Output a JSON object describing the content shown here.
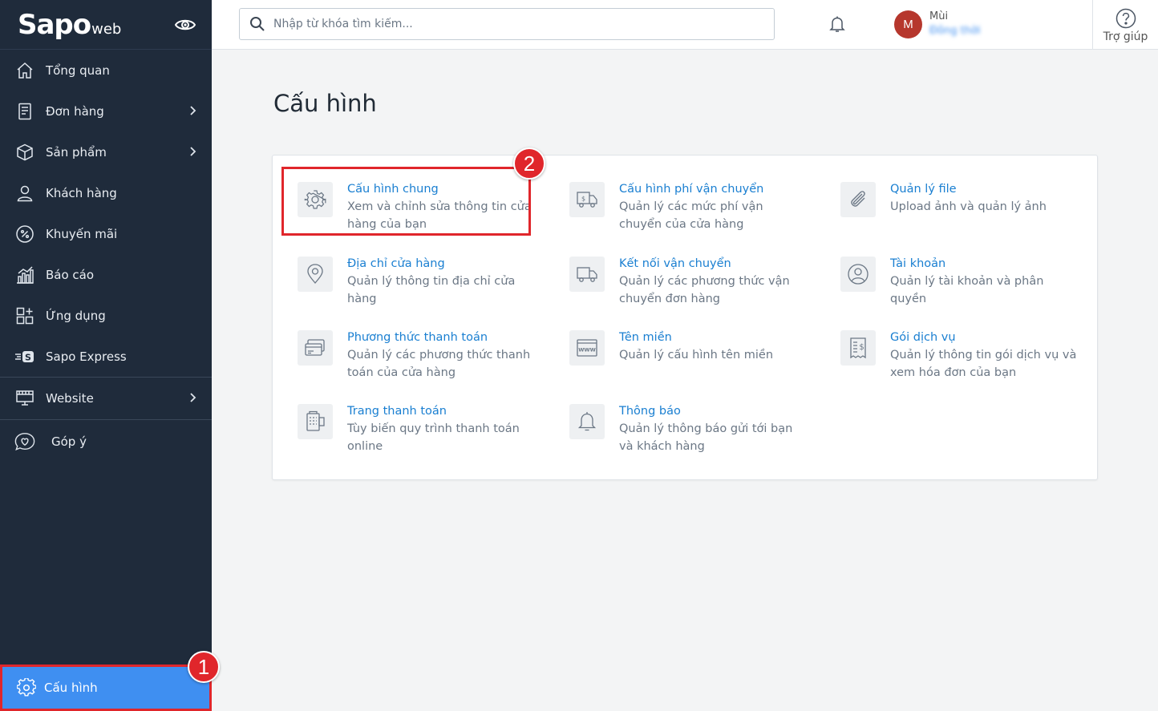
{
  "brand": {
    "logo_main": "Sapo",
    "logo_sub": "web"
  },
  "sidebar": {
    "items": [
      {
        "label": "Tổng quan",
        "icon": "home-icon"
      },
      {
        "label": "Đơn hàng",
        "icon": "order-icon",
        "has_children": true
      },
      {
        "label": "Sản phẩm",
        "icon": "box-icon",
        "has_children": true
      },
      {
        "label": "Khách hàng",
        "icon": "user-icon"
      },
      {
        "label": "Khuyến mãi",
        "icon": "percent-icon"
      },
      {
        "label": "Báo cáo",
        "icon": "report-icon"
      },
      {
        "label": "Ứng dụng",
        "icon": "apps-icon"
      },
      {
        "label": "Sapo Express",
        "icon": "express-icon"
      }
    ],
    "website": {
      "label": "Website",
      "icon": "store-icon"
    },
    "feedback": {
      "label": "Góp ý",
      "icon": "heart-chat-icon"
    },
    "settings": {
      "label": "Cấu hình",
      "icon": "gear-icon",
      "active": true
    }
  },
  "topbar": {
    "search_placeholder": "Nhập từ khóa tìm kiếm...",
    "user_initial": "M",
    "user_name": "Mùi",
    "user_store": "Đông thời",
    "help_label": "Trợ giúp"
  },
  "page": {
    "title": "Cấu hình"
  },
  "cards": [
    {
      "title": "Cấu hình chung",
      "desc": "Xem và chỉnh sửa thông tin cửa hàng của bạn",
      "icon": "gear-icon"
    },
    {
      "title": "Cấu hình phí vận chuyển",
      "desc": "Quản lý các mức phí vận chuyển của cửa hàng",
      "icon": "shipping-fee-icon"
    },
    {
      "title": "Quản lý file",
      "desc": "Upload ảnh và quản lý ảnh",
      "icon": "paperclip-icon"
    },
    {
      "title": "Địa chỉ cửa hàng",
      "desc": "Quản lý thông tin địa chỉ cửa hàng",
      "icon": "location-pin-icon"
    },
    {
      "title": "Kết nối vận chuyển",
      "desc": "Quản lý các phương thức vận chuyển đơn hàng",
      "icon": "truck-icon"
    },
    {
      "title": "Tài khoản",
      "desc": "Quản lý tài khoản và phân quyền",
      "icon": "account-icon"
    },
    {
      "title": "Phương thức thanh toán",
      "desc": "Quản lý các phương thức thanh toán của cửa hàng",
      "icon": "credit-card-icon"
    },
    {
      "title": "Tên miền",
      "desc": "Quản lý cấu hình tên miền",
      "icon": "www-icon"
    },
    {
      "title": "Gói dịch vụ",
      "desc": "Quản lý thông tin gói dịch vụ và xem hóa đơn của bạn",
      "icon": "invoice-icon"
    },
    {
      "title": "Trang thanh toán",
      "desc": "Tùy biến quy trình thanh toán online",
      "icon": "checkout-page-icon"
    },
    {
      "title": "Thông báo",
      "desc": "Quản lý thông báo gửi tới bạn và khách hàng",
      "icon": "bell-icon"
    }
  ],
  "annotations": {
    "badge_1": "1",
    "badge_2": "2"
  },
  "colors": {
    "sidebar_bg": "#1f2b3b",
    "active_bg": "#3f8ff1",
    "link": "#1a7fd1",
    "highlight": "#e0262b"
  }
}
